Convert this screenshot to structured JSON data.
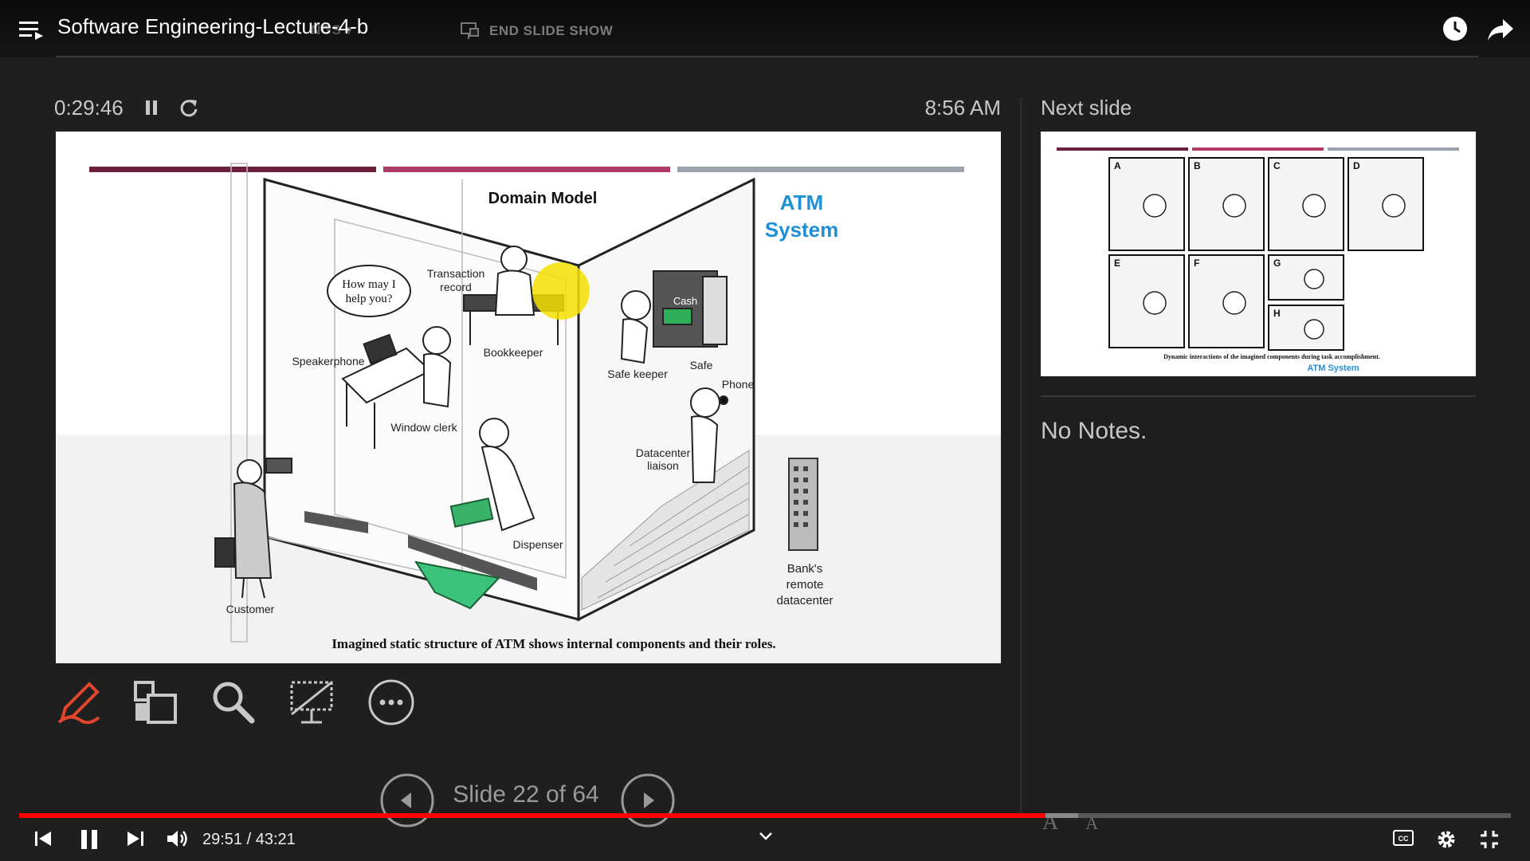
{
  "video": {
    "title": "Software Engineering-Lecture-4-b",
    "time_display": "29:51 / 43:21",
    "progress": 0.688,
    "buffered": 0.71
  },
  "presenter_toolbar": {
    "settings_label": "NGS ▾",
    "end_show_label": "END SLIDE SHOW"
  },
  "presenter": {
    "timer": "0:29:46",
    "clock": "8:56 AM",
    "next_slide_label": "Next slide",
    "notes": "No Notes.",
    "slide_counter": "Slide 22 of 64",
    "font_increase": "A",
    "font_decrease": "A"
  },
  "current_slide": {
    "title": "Domain Model",
    "brand_line1": "ATM",
    "brand_line2": "System",
    "caption": "Imagined static structure of ATM shows internal components and their roles.",
    "speech_line1": "How may I",
    "speech_line2": "help you?",
    "labels": {
      "transaction_record_1": "Transaction",
      "transaction_record_2": "record",
      "bookkeeper": "Bookkeeper",
      "speakerphone": "Speakerphone",
      "window_clerk": "Window clerk",
      "cash": "Cash",
      "safe_keeper": "Safe keeper",
      "safe": "Safe",
      "phone": "Phone",
      "datacenter_1": "Datacenter",
      "datacenter_2": "liaison",
      "dispenser": "Dispenser",
      "customer": "Customer",
      "bank_1": "Bank's",
      "bank_2": "remote",
      "bank_3": "datacenter"
    },
    "colors": {
      "bar1": "#6b1f3d",
      "bar2": "#b03a66",
      "bar3": "#9aa3ad",
      "brand": "#1f8fd6",
      "highlight": "#f5e000"
    }
  },
  "next_slide": {
    "panel_letters": [
      "A",
      "B",
      "C",
      "D",
      "E",
      "F",
      "G",
      "H"
    ],
    "caption": "Dynamic interactions of the imagined components during task accomplishment.",
    "brand": "ATM System"
  },
  "icons": [
    "menu-icon",
    "end-show-icon",
    "clock-icon",
    "share-icon",
    "pen-icon",
    "slides-grid-icon",
    "zoom-icon",
    "black-screen-icon",
    "more-options-icon",
    "prev-arrow-icon",
    "next-arrow-icon",
    "skip-back-icon",
    "pause-icon",
    "skip-next-icon",
    "volume-icon",
    "chevron-down-icon",
    "captions-icon",
    "settings-gear-icon",
    "exit-fullscreen-icon"
  ],
  "colors": {
    "progress": "#ff0000",
    "pen_tool": "#e0462e"
  }
}
